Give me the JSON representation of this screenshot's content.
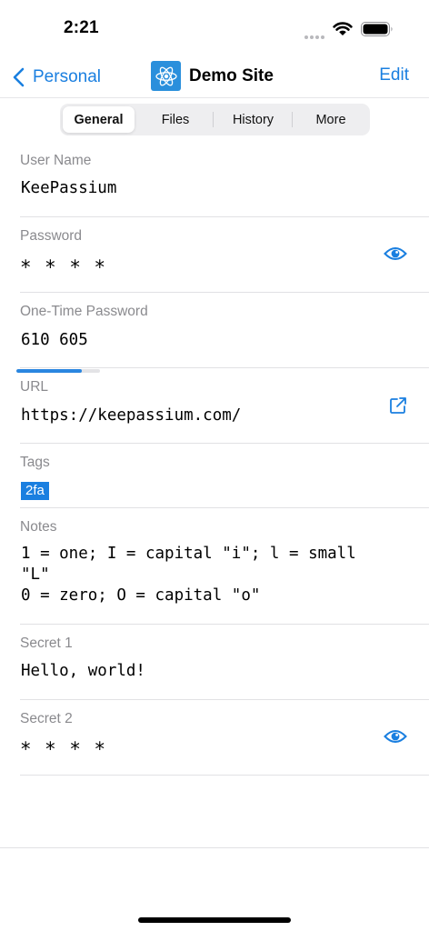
{
  "status_bar": {
    "time": "2:21"
  },
  "nav": {
    "back_label": "Personal",
    "title": "Demo Site",
    "edit_label": "Edit"
  },
  "tabs": [
    {
      "label": "General",
      "selected": true
    },
    {
      "label": "Files",
      "selected": false
    },
    {
      "label": "History",
      "selected": false
    },
    {
      "label": "More",
      "selected": false
    }
  ],
  "fields": {
    "username": {
      "label": "User Name",
      "value": "KeePassium"
    },
    "password": {
      "label": "Password",
      "value": "* * * *",
      "action_icon": "eye-icon"
    },
    "otp": {
      "label": "One-Time Password",
      "value": "610 605",
      "remaining_fraction": 0.78
    },
    "url": {
      "label": "URL",
      "value": "https://keepassium.com/",
      "action_icon": "open-external-icon"
    },
    "tags": {
      "label": "Tags",
      "items": [
        "2fa"
      ]
    },
    "notes": {
      "label": "Notes",
      "line1": "1 = one; I = capital \"i\"; l = small",
      "line2": "\"L\"",
      "line3": "0 = zero; O = capital \"o\""
    },
    "secret1": {
      "label": "Secret 1",
      "value": "Hello, world!"
    },
    "secret2": {
      "label": "Secret 2",
      "value": "* * * *",
      "action_icon": "eye-icon"
    }
  },
  "colors": {
    "accent": "#1a7fe0",
    "label_gray": "#8a8a8e",
    "separator": "#e1e1e4",
    "logo_bg": "#2a8fdc"
  }
}
